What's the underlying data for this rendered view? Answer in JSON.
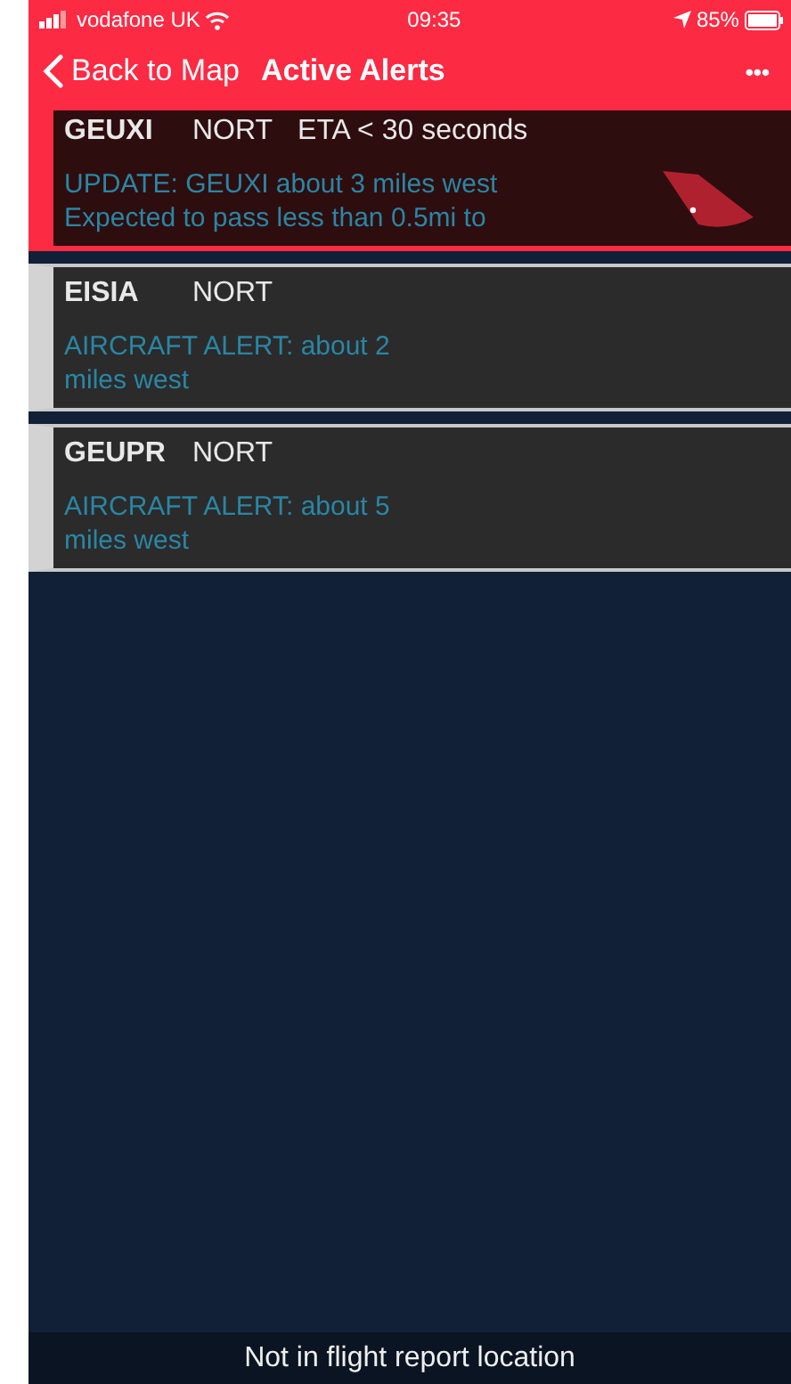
{
  "status_bar": {
    "carrier": "vodafone UK",
    "time": "09:35",
    "battery": "85%"
  },
  "nav": {
    "back": "Back to Map",
    "title": "Active Alerts",
    "menu": "•••"
  },
  "alerts": [
    {
      "kind": "urgent",
      "callsign": "GEUXI",
      "type": "NORT",
      "eta": "ETA < 30 seconds",
      "message": "UPDATE: GEUXI about 3 miles west\nExpected to pass less than 0.5mi to"
    },
    {
      "kind": "normal",
      "callsign": "EISIA",
      "type": "NORT",
      "message": "AIRCRAFT ALERT: about 2\nmiles west"
    },
    {
      "kind": "normal",
      "callsign": "GEUPR",
      "type": "NORT",
      "message": "AIRCRAFT ALERT: about 5\nmiles west"
    }
  ],
  "footer": "Not in flight report location"
}
